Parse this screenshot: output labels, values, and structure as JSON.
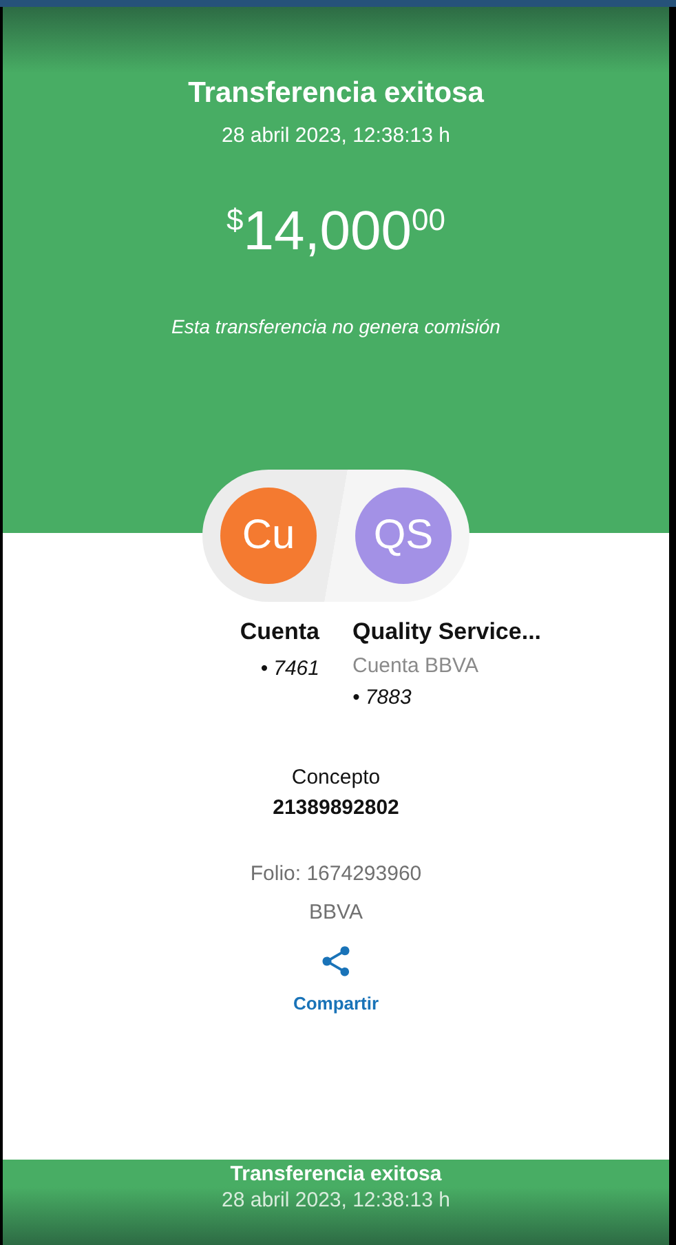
{
  "header": {
    "title": "Transferencia exitosa",
    "date": "28 abril 2023, 12:38:13 h",
    "amount": {
      "currency": "$",
      "integer": "14,000",
      "cents": "00"
    },
    "note": "Esta transferencia no genera comisión"
  },
  "parties": [
    {
      "initials": "Cu",
      "color": "#f47a30",
      "name": "Cuenta",
      "account": "• 7461"
    },
    {
      "initials": "QS",
      "color": "#a391e6",
      "name": "Quality Service...",
      "subtitle": "Cuenta BBVA",
      "account": "• 7883"
    }
  ],
  "concept": {
    "label": "Concepto",
    "value": "21389892802"
  },
  "folio": "Folio: 1674293960",
  "bank": "BBVA",
  "share": {
    "label": "Compartir"
  },
  "footer": {
    "title": "Transferencia exitosa",
    "date": "28 abril 2023, 12:38:13 h"
  }
}
